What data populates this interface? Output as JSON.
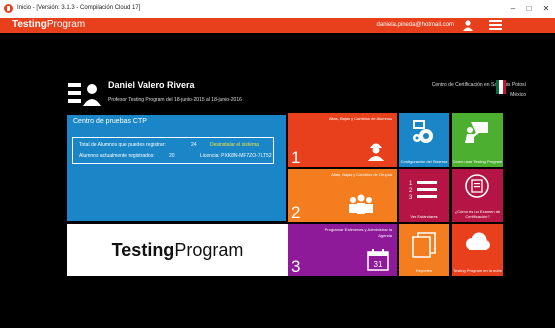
{
  "window": {
    "title": "Inicio - [Versión: 3.1.3 - Compilación Cloud 17]",
    "minimize": "–",
    "maximize": "□",
    "close": "✕"
  },
  "appbar": {
    "brand_bold": "Testing",
    "brand_light": "Program",
    "email": "daniela.pineda@hotmail.com"
  },
  "profile": {
    "name": "Daniel Valero Rivera",
    "period": "Profesor Testing Program del 18-junio-2015 al 18-junio-2016"
  },
  "center": {
    "line1": "Centro de Certificación en San Luis Potosí",
    "line2": "México"
  },
  "test_center": {
    "title": "Centro de pruebas CTP",
    "remaining_label": "Total de Alumnos que puedes registrar:",
    "remaining": "24",
    "registered_label": "Alumnos actualmente registrados:",
    "registered": "20",
    "unregister": "Desinstalar el sistema",
    "license": "Licencia: PXK8N-MF7ZO-7LT52"
  },
  "logo": {
    "bold": "Testing",
    "light": "Program"
  },
  "tiles": {
    "students": {
      "label": "Altas, Bajas y Cambios de Alumnos",
      "num": "1"
    },
    "groups": {
      "label": "Altas, Bajas y Cambios de Grupos",
      "num": "2"
    },
    "exams": {
      "label": "Programar Exámenes y Administrar la Agenda",
      "num": "3"
    },
    "calendar_day": "31",
    "config": {
      "label": "Configuración del Sistema"
    },
    "how": {
      "label": "Cómo usar Testing Program"
    },
    "list": {
      "label": "Ver Estándares"
    },
    "exam_info": {
      "label": "¿Cómo es un Examen de Certificación?"
    },
    "reports": {
      "label": "Reportes"
    },
    "cloud": {
      "label": "Testing Program en la nube"
    }
  },
  "colors": {
    "accent": "#e8401c",
    "blue": "#1a86c8",
    "orange": "#f47d1f",
    "green": "#4caf30",
    "purple": "#8e1a9a",
    "crimson": "#b51545"
  }
}
